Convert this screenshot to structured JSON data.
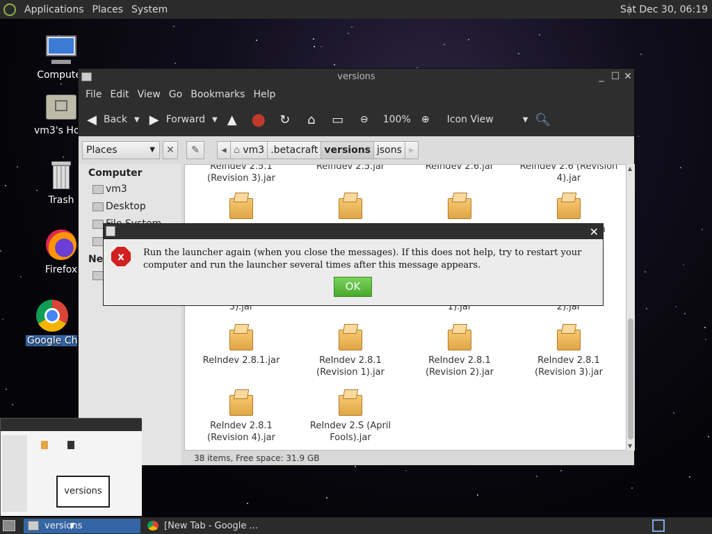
{
  "top_panel": {
    "menus": [
      "Applications",
      "Places",
      "System"
    ],
    "clock": "Sat Dec 30, 06:19"
  },
  "desktop_icons": [
    {
      "label": "Computer",
      "icon": "computer-icon"
    },
    {
      "label": "vm3's Home",
      "icon": "home-folder-icon"
    },
    {
      "label": "Trash",
      "icon": "trash-icon"
    },
    {
      "label": "Firefox",
      "icon": "firefox-icon"
    },
    {
      "label": "Google Chrome",
      "icon": "chrome-icon"
    }
  ],
  "window": {
    "title": "versions",
    "menus": [
      "File",
      "Edit",
      "View",
      "Go",
      "Bookmarks",
      "Help"
    ],
    "toolbar": {
      "back": "Back",
      "forward": "Forward",
      "zoom": "100%",
      "view_mode": "Icon View"
    },
    "places_select": "Places",
    "breadcrumbs": [
      "vm3",
      ".betacraft",
      "versions",
      "jsons"
    ],
    "sidebar": {
      "heading": "Computer",
      "items": [
        "vm3",
        "Desktop",
        "File System"
      ],
      "network_heading": "Network"
    },
    "files": [
      "ReIndev 2.5.1 (Revision 3).jar",
      "ReIndev 2.5.jar",
      "ReIndev 2.6.jar",
      "ReIndev 2.6 (Revision 4).jar",
      "",
      "",
      "",
      "",
      "ReIndev 2.8.1.jar",
      "ReIndev 2.8.1 (Revision 1).jar",
      "ReIndev 2.8.1 (Revision 2).jar",
      "ReIndev 2.8.1 (Revision 3).jar",
      "ReIndev 2.8.1 (Revision 4).jar",
      "ReIndev 2.S (April Fools).jar"
    ],
    "partial_labels": {
      "row2_right": "ion",
      "row2_bottom": [
        "3).jar",
        "1).jar",
        "2).jar"
      ],
      "row2_right2": "on"
    },
    "status": "38 items, Free space: 31.9 GB"
  },
  "dialog": {
    "message": "Run the launcher again (when you close the messages). If this does not help, try to restart your computer and run the launcher several times after this message appears.",
    "ok_label": "OK"
  },
  "preview": {
    "label": "versions"
  },
  "taskbar": {
    "tasks": [
      "versions",
      "[New Tab - Google ..."
    ]
  }
}
